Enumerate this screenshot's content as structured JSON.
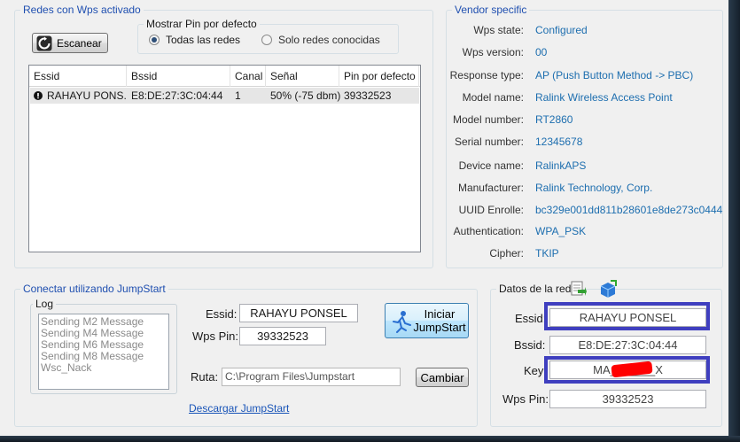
{
  "redes": {
    "legend": "Redes con Wps activado",
    "scan_button": "Escanear",
    "pin_group": {
      "legend": "Mostrar Pin por defecto",
      "option_all": "Todas las redes",
      "option_known": "Solo redes conocidas",
      "selected": "Todas las redes"
    },
    "columns": [
      "Essid",
      "Bssid",
      "Canal",
      "Señal",
      "Pin por defecto"
    ],
    "rows": [
      {
        "essid": "RAHAYU PONS...",
        "bssid": "E8:DE:27:3C:04:44",
        "canal": "1",
        "senal": "50% (-75 dbm)",
        "pin": "39332523"
      }
    ]
  },
  "vendor": {
    "legend": "Vendor specific",
    "fields": [
      {
        "label": "Wps state:",
        "value": "Configured"
      },
      {
        "label": "Wps version:",
        "value": "00"
      },
      {
        "label": "Response type:",
        "value": "AP (Push Button Method -> PBC)"
      },
      {
        "label": "Model name:",
        "value": "Ralink Wireless Access Point"
      },
      {
        "label": "Model number:",
        "value": "RT2860"
      },
      {
        "label": "Serial number:",
        "value": "12345678"
      },
      {
        "label": "Device name:",
        "value": "RalinkAPS"
      },
      {
        "label": "Manufacturer:",
        "value": "Ralink Technology, Corp."
      },
      {
        "label": "UUID Enrolle:",
        "value": "bc329e001dd811b28601e8de273c0444"
      },
      {
        "label": "Authentication:",
        "value": "WPA_PSK"
      },
      {
        "label": "Cipher:",
        "value": "TKIP"
      }
    ]
  },
  "jumpstart": {
    "legend": "Conectar utilizando JumpStart",
    "log_legend": "Log",
    "log_lines": [
      "Sending M2 Message",
      "Sending M4 Message",
      "Sending M6 Message",
      "Sending M8 Message",
      "Wsc_Nack"
    ],
    "essid_label": "Essid:",
    "essid_value": "RAHAYU PONSEL",
    "pin_label": "Wps Pin:",
    "pin_value": "39332523",
    "start_button_line1": "Iniciar",
    "start_button_line2": "JumpStart",
    "ruta_label": "Ruta:",
    "ruta_value": "C:\\Program Files\\Jumpstart",
    "change_button": "Cambiar",
    "download_link": "Descargar JumpStart"
  },
  "datos": {
    "legend": "Datos de la red",
    "essid_label": "Essid:",
    "essid_value": "RAHAYU PONSEL",
    "bssid_label": "Bssid:",
    "bssid_value": "E8:DE:27:3C:04:44",
    "key_label": "Key",
    "key_value": "MA_______X",
    "pin_label": "Wps Pin:",
    "pin_value": "39332523"
  },
  "colors": {
    "legend_blue": "#1f4fb0",
    "value_blue": "#1d6eaf",
    "highlight": "#3f3fbf",
    "redaction": "#ff0000"
  }
}
